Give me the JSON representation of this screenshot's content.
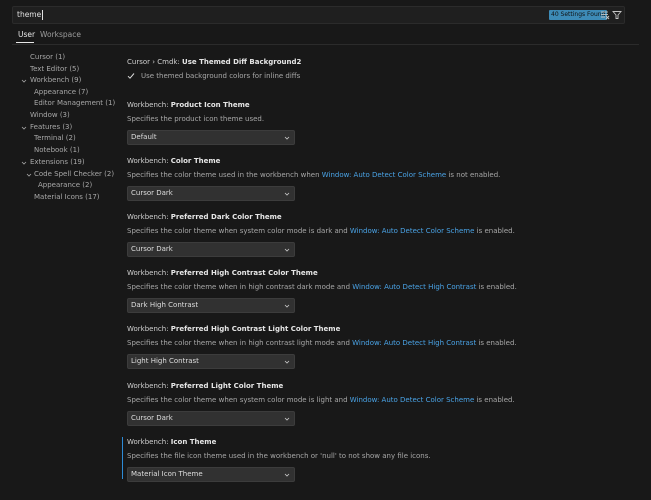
{
  "search": {
    "query": "theme",
    "results_badge": "40 Settings Found",
    "clear_icon": "clear-filter-icon",
    "filter_icon": "filter-icon"
  },
  "tabs": [
    {
      "label": "User",
      "active": true
    },
    {
      "label": "Workspace",
      "active": false
    }
  ],
  "toc": [
    {
      "label": "Cursor (1)",
      "level": 0,
      "expandable": false
    },
    {
      "label": "Text Editor (5)",
      "level": 0,
      "expandable": false
    },
    {
      "label": "Workbench (9)",
      "level": 0,
      "expandable": true
    },
    {
      "label": "Appearance (7)",
      "level": 1,
      "expandable": false
    },
    {
      "label": "Editor Management (1)",
      "level": 1,
      "expandable": false
    },
    {
      "label": "Window (3)",
      "level": 0,
      "expandable": false
    },
    {
      "label": "Features (3)",
      "level": 0,
      "expandable": true
    },
    {
      "label": "Terminal (2)",
      "level": 1,
      "expandable": false
    },
    {
      "label": "Notebook (1)",
      "level": 1,
      "expandable": false
    },
    {
      "label": "Extensions (19)",
      "level": 0,
      "expandable": true
    },
    {
      "label": "Code Spell Checker (2)",
      "level": 1,
      "expandable": true
    },
    {
      "label": "Appearance (2)",
      "level": 2,
      "expandable": false
    },
    {
      "label": "Material Icons (17)",
      "level": 1,
      "expandable": false
    }
  ],
  "settings": [
    {
      "category": "Cursor › Cmdk: ",
      "name": "Use Themed Diff Background2",
      "checkbox_label": "Use themed background colors for inline diffs",
      "checked": true
    },
    {
      "category": "Workbench: ",
      "name": "Product Icon Theme",
      "desc_before": "Specifies the product icon theme used.",
      "value": "Default"
    },
    {
      "category": "Workbench: ",
      "name": "Color Theme",
      "desc_before": "Specifies the color theme used in the workbench when ",
      "desc_link": "Window: Auto Detect Color Scheme",
      "desc_after": " is not enabled.",
      "value": "Cursor Dark"
    },
    {
      "category": "Workbench: ",
      "name": "Preferred Dark Color Theme",
      "desc_before": "Specifies the color theme when system color mode is dark and ",
      "desc_link": "Window: Auto Detect Color Scheme",
      "desc_after": " is enabled.",
      "value": "Cursor Dark"
    },
    {
      "category": "Workbench: ",
      "name": "Preferred High Contrast Color Theme",
      "desc_before": "Specifies the color theme when in high contrast dark mode and ",
      "desc_link": "Window: Auto Detect High Contrast",
      "desc_after": " is enabled.",
      "value": "Dark High Contrast"
    },
    {
      "category": "Workbench: ",
      "name": "Preferred High Contrast Light Color Theme",
      "desc_before": "Specifies the color theme when in high contrast light mode and ",
      "desc_link": "Window: Auto Detect High Contrast",
      "desc_after": " is enabled.",
      "value": "Light High Contrast"
    },
    {
      "category": "Workbench: ",
      "name": "Preferred Light Color Theme",
      "desc_before": "Specifies the color theme when system color mode is light and ",
      "desc_link": "Window: Auto Detect Color Scheme",
      "desc_after": " is enabled.",
      "value": "Cursor Dark"
    },
    {
      "category": "Workbench: ",
      "name": "Icon Theme",
      "desc_before": "Specifies the file icon theme used in the workbench or 'null' to not show any file icons.",
      "value": "Material Icon Theme",
      "focused": true
    }
  ],
  "colors": {
    "background": "#181818",
    "link": "#4aa3e6",
    "badge": "#3d8bb7",
    "focus": "#2d8bd6"
  }
}
